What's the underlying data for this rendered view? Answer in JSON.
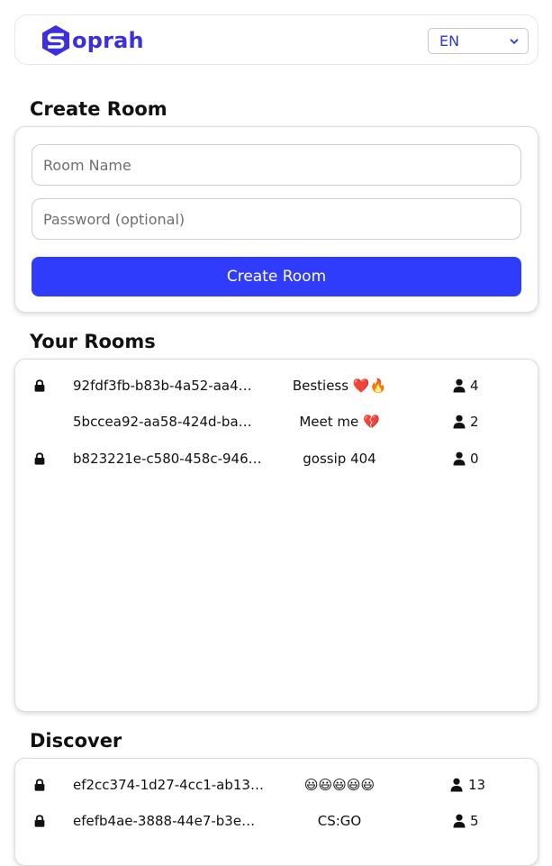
{
  "header": {
    "logo_text": "oprah",
    "language": {
      "selected": "EN"
    }
  },
  "create_room": {
    "title": "Create Room",
    "room_name_placeholder": "Room Name",
    "password_placeholder": "Password (optional)",
    "submit_label": "Create Room"
  },
  "your_rooms": {
    "title": "Your Rooms",
    "rooms": [
      {
        "id": "92fdf3fb-b83b-4a52-aa4…",
        "name": "Bestiess ❤️🔥",
        "locked": true,
        "members": "4"
      },
      {
        "id": "5bccea92-aa58-424d-ba…",
        "name": "Meet me 💔",
        "locked": false,
        "members": "2"
      },
      {
        "id": "b823221e-c580-458c-946…",
        "name": "gossip 404",
        "locked": true,
        "members": "0"
      }
    ]
  },
  "discover": {
    "title": "Discover",
    "rooms": [
      {
        "id": "ef2cc374-1d27-4cc1-ab13…",
        "name": "😃😃😃😃😃",
        "locked": true,
        "members": "13"
      },
      {
        "id": "efefb4ae-3888-44e7-b3e…",
        "name": "CS:GO",
        "locked": true,
        "members": "5"
      }
    ]
  },
  "colors": {
    "brand": "#3b2fe0",
    "primary_button": "#2f3cfb",
    "select_text": "#2c3ad6"
  },
  "icons": {
    "lock": "lock-icon",
    "user": "user-icon",
    "chevron": "chevron-down-icon",
    "logo": "sopra-logo-icon"
  }
}
